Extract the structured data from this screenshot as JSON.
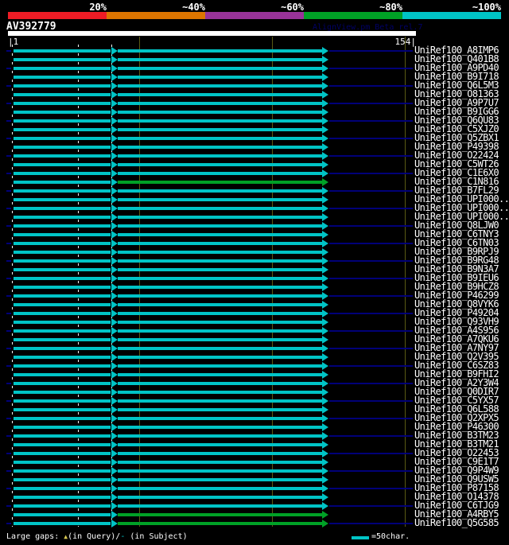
{
  "colors": {
    "background": "#000000",
    "bar_high": "#00c4c6",
    "bar_mid": "#00a126",
    "extension_navy": "#000078",
    "guide_olive": "#5a5a14",
    "query_bar": "#ffffff",
    "watermark_navy": "#000066",
    "gap_triangle_yellow": "#d8c850",
    "legend_swatch": "#00c4c6"
  },
  "query": {
    "title": "AV392779",
    "watermark": "AlignView.pm Beta rel.7",
    "ruler_left": "|1",
    "ruler_right": "154|"
  },
  "footer": {
    "label": "Large gaps: ",
    "query_marker": "▲",
    "query_text": "(in Query)/",
    "subject_marker": "-",
    "subject_text": " (in Subject)",
    "legend_text": "=50char."
  },
  "chart_data": {
    "type": "table",
    "title": "AV392779",
    "subtitle": "AlignView.pm Beta rel.7",
    "query_range": [
      1,
      154
    ],
    "ruler_gridline_positions": [
      50,
      100,
      150
    ],
    "query_gap_column_positions": [
      2,
      27,
      40
    ],
    "identity_scale": {
      "labels": [
        "20%",
        "~40%",
        "~60%",
        "~80%",
        "~100%"
      ],
      "colors": [
        "#ee1c25",
        "#dd7500",
        "#993399",
        "#00a126",
        "#00c4c6"
      ]
    },
    "legend": {
      "swatch_meaning": "=50char.",
      "gap_note": "Large gaps: ▲(in Query)/- (in Subject)"
    },
    "hits": [
      {
        "label": "UniRef100_A8IMP6",
        "second_segment": "high",
        "subject_overhang": true
      },
      {
        "label": "UniRef100_Q401B8",
        "second_segment": "high",
        "subject_overhang": false
      },
      {
        "label": "UniRef100_A9PD40",
        "second_segment": "high",
        "subject_overhang": true
      },
      {
        "label": "UniRef100_B9I718",
        "second_segment": "high",
        "subject_overhang": false
      },
      {
        "label": "UniRef100_Q6L5M3",
        "second_segment": "high",
        "subject_overhang": true
      },
      {
        "label": "UniRef100_O81363",
        "second_segment": "high",
        "subject_overhang": false
      },
      {
        "label": "UniRef100_A9P7U7",
        "second_segment": "high",
        "subject_overhang": true
      },
      {
        "label": "UniRef100_B9IGG6",
        "second_segment": "high",
        "subject_overhang": false
      },
      {
        "label": "UniRef100_Q6QU83",
        "second_segment": "high",
        "subject_overhang": true
      },
      {
        "label": "UniRef100_C5XJZ0",
        "second_segment": "high",
        "subject_overhang": false
      },
      {
        "label": "UniRef100_Q5ZBX1",
        "second_segment": "high",
        "subject_overhang": true
      },
      {
        "label": "UniRef100_P49398",
        "second_segment": "high",
        "subject_overhang": false
      },
      {
        "label": "UniRef100_O22424",
        "second_segment": "high",
        "subject_overhang": true
      },
      {
        "label": "UniRef100_C5WT26",
        "second_segment": "high",
        "subject_overhang": false
      },
      {
        "label": "UniRef100_C1E6X0",
        "second_segment": "high",
        "subject_overhang": true
      },
      {
        "label": "UniRef100_C1N816",
        "second_segment": "mid",
        "subject_overhang": false
      },
      {
        "label": "UniRef100_B7FL29",
        "second_segment": "high",
        "subject_overhang": true
      },
      {
        "label": "UniRef100_UPI000..",
        "second_segment": "high",
        "subject_overhang": false
      },
      {
        "label": "UniRef100_UPI000..",
        "second_segment": "high",
        "subject_overhang": true
      },
      {
        "label": "UniRef100_UPI000..",
        "second_segment": "high",
        "subject_overhang": false
      },
      {
        "label": "UniRef100_Q8LJW0",
        "second_segment": "high",
        "subject_overhang": true
      },
      {
        "label": "UniRef100_C6TNY3",
        "second_segment": "high",
        "subject_overhang": false
      },
      {
        "label": "UniRef100_C6TN03",
        "second_segment": "high",
        "subject_overhang": true
      },
      {
        "label": "UniRef100_B9RPJ9",
        "second_segment": "high",
        "subject_overhang": false
      },
      {
        "label": "UniRef100_B9RG48",
        "second_segment": "high",
        "subject_overhang": true
      },
      {
        "label": "UniRef100_B9N3A7",
        "second_segment": "high",
        "subject_overhang": false
      },
      {
        "label": "UniRef100_B9IEU6",
        "second_segment": "high",
        "subject_overhang": true
      },
      {
        "label": "UniRef100_B9HCZ8",
        "second_segment": "high",
        "subject_overhang": false
      },
      {
        "label": "UniRef100_P46299",
        "second_segment": "high",
        "subject_overhang": true
      },
      {
        "label": "UniRef100_Q8VYK6",
        "second_segment": "high",
        "subject_overhang": false
      },
      {
        "label": "UniRef100_P49204",
        "second_segment": "high",
        "subject_overhang": true
      },
      {
        "label": "UniRef100_Q93VH9",
        "second_segment": "high",
        "subject_overhang": false
      },
      {
        "label": "UniRef100_A4S956",
        "second_segment": "high",
        "subject_overhang": true
      },
      {
        "label": "UniRef100_A7QKU6",
        "second_segment": "high",
        "subject_overhang": false
      },
      {
        "label": "UniRef100_A7NY97",
        "second_segment": "high",
        "subject_overhang": true
      },
      {
        "label": "UniRef100_Q2V395",
        "second_segment": "high",
        "subject_overhang": false
      },
      {
        "label": "UniRef100_C6SZ83",
        "second_segment": "high",
        "subject_overhang": true
      },
      {
        "label": "UniRef100_B9FHI2",
        "second_segment": "high",
        "subject_overhang": false
      },
      {
        "label": "UniRef100_A2Y3W4",
        "second_segment": "high",
        "subject_overhang": true
      },
      {
        "label": "UniRef100_Q0DIR7",
        "second_segment": "high",
        "subject_overhang": false
      },
      {
        "label": "UniRef100_C5YX57",
        "second_segment": "high",
        "subject_overhang": true
      },
      {
        "label": "UniRef100_Q6L588",
        "second_segment": "high",
        "subject_overhang": false
      },
      {
        "label": "UniRef100_Q2XPX5",
        "second_segment": "high",
        "subject_overhang": true
      },
      {
        "label": "UniRef100_P46300",
        "second_segment": "high",
        "subject_overhang": false
      },
      {
        "label": "UniRef100_B3TM23",
        "second_segment": "high",
        "subject_overhang": true
      },
      {
        "label": "UniRef100_B3TM21",
        "second_segment": "high",
        "subject_overhang": false
      },
      {
        "label": "UniRef100_O22453",
        "second_segment": "high",
        "subject_overhang": true
      },
      {
        "label": "UniRef100_C9E1T7",
        "second_segment": "high",
        "subject_overhang": false
      },
      {
        "label": "UniRef100_Q9P4W9",
        "second_segment": "high",
        "subject_overhang": true
      },
      {
        "label": "UniRef100_Q9USW5",
        "second_segment": "high",
        "subject_overhang": false
      },
      {
        "label": "UniRef100_P87158",
        "second_segment": "high",
        "subject_overhang": true
      },
      {
        "label": "UniRef100_O14378",
        "second_segment": "high",
        "subject_overhang": false
      },
      {
        "label": "UniRef100_C6TJG9",
        "second_segment": "high",
        "subject_overhang": true
      },
      {
        "label": "UniRef100_A4RBY5",
        "second_segment": "mid",
        "subject_overhang": false
      },
      {
        "label": "UniRef100_Q5G585",
        "second_segment": "mid",
        "subject_overhang": true
      }
    ]
  }
}
